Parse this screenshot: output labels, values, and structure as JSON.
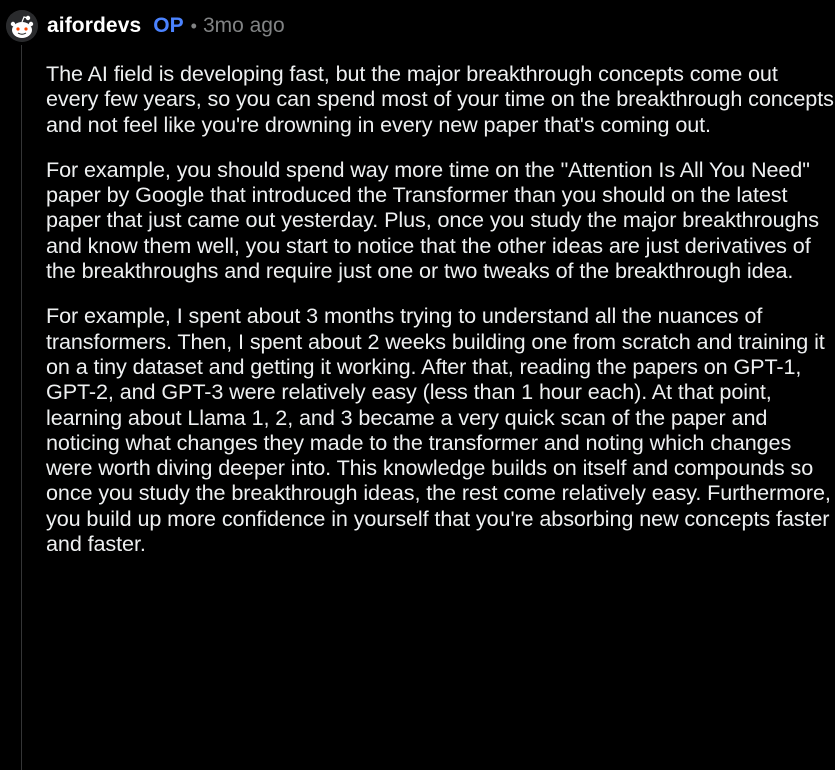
{
  "comment": {
    "author": "aifordevs",
    "badge": "OP",
    "separator": "•",
    "timestamp": "3mo ago",
    "avatar_icon": "snoo-avatar-icon",
    "colors": {
      "background": "#000000",
      "text": "#eef0f1",
      "op_badge": "#4b83ff",
      "meta": "#818384"
    },
    "paragraphs": [
      "The AI field is developing fast, but the major breakthrough concepts come out every few years, so you can spend most of your time on the breakthrough concepts and not feel like you're drowning in every new paper that's coming out.",
      "For example, you should spend way more time on the \"Attention Is All You Need\" paper by Google that introduced the Transformer than you should on the latest paper that just came out yesterday. Plus, once you study the major breakthroughs and know them well, you start to notice that the other ideas are just derivatives of the breakthroughs and require just one or two tweaks of the breakthrough idea.",
      "For example, I spent about 3 months trying to understand all the nuances of transformers. Then, I spent about 2 weeks building one from scratch and training it on a tiny dataset and getting it working. After that, reading the papers on GPT-1, GPT-2, and GPT-3 were relatively easy (less than 1 hour each). At that point, learning about Llama 1, 2, and 3 became a very quick scan of the paper and noticing what changes they made to the transformer and noting which changes were worth diving deeper into. This knowledge builds on itself and compounds so once you study the breakthrough ideas, the rest come relatively easy. Furthermore, you build up more confidence in yourself that you're absorbing new concepts faster and faster."
    ]
  }
}
